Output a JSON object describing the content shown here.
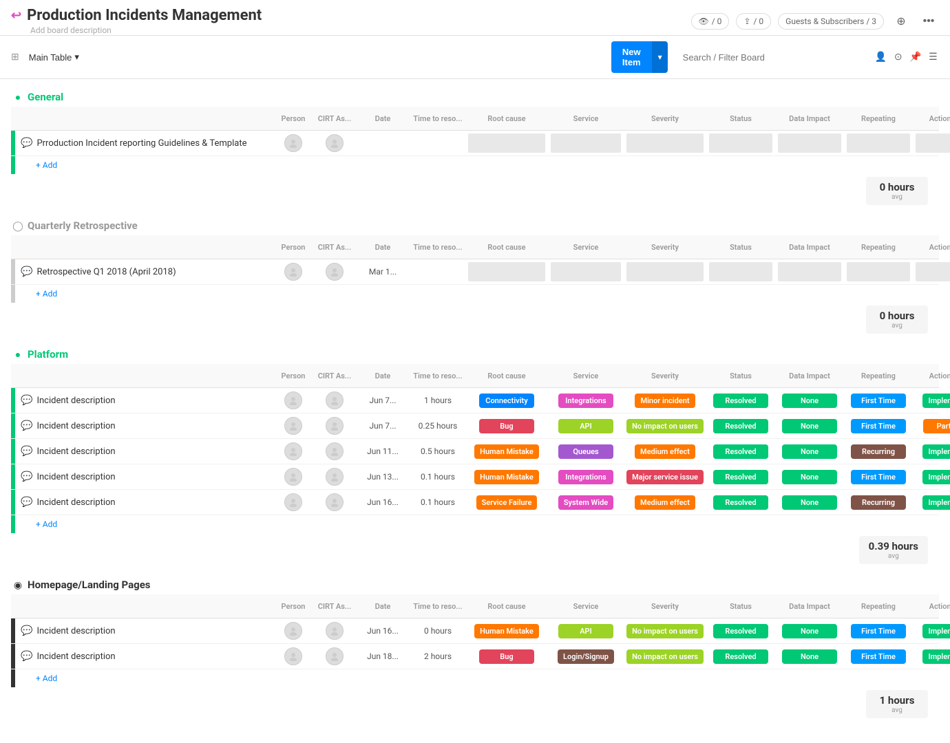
{
  "app": {
    "title": "Production Incidents Management",
    "title_icon": "↩",
    "board_desc": "Add board description",
    "counters": {
      "eye": "/ 0",
      "share": "/ 0",
      "guests": "Guests & Subscribers / 3"
    }
  },
  "toolbar": {
    "table_label": "Main Table",
    "new_item_label": "New Item",
    "search_placeholder": "Search / Filter Board"
  },
  "columns": [
    "Person",
    "CIRT As...",
    "Date",
    "Time to reso...",
    "Root cause",
    "Service",
    "Severity",
    "Status",
    "Data Impact",
    "Repeating",
    "Action Items"
  ],
  "groups": [
    {
      "id": "general",
      "title": "General",
      "color": "green",
      "indicator_color": "green",
      "rows": [
        {
          "name": "Prroduction Incident reporting Guidelines & Template",
          "date": "",
          "time": "",
          "has_tags": false
        }
      ],
      "summary": "0 hours",
      "summary_label": "avg"
    },
    {
      "id": "quarterly",
      "title": "Quarterly Retrospective",
      "color": "gray",
      "indicator_color": "gray",
      "rows": [
        {
          "name": "Retrospective Q1 2018 (April 2018)",
          "date": "Mar 1...",
          "time": "",
          "has_tags": false
        }
      ],
      "summary": "0 hours",
      "summary_label": "avg"
    },
    {
      "id": "platform",
      "title": "Platform",
      "color": "green",
      "indicator_color": "green",
      "rows": [
        {
          "name": "Incident description",
          "date": "Jun 7...",
          "time": "1 hours",
          "root_cause": "Connectivity",
          "root_cause_color": "tag-blue",
          "service": "Integrations",
          "service_color": "tag-pink",
          "severity": "Minor incident",
          "severity_color": "tag-orange",
          "status": "Resolved",
          "status_color": "tag-green",
          "impact": "None",
          "impact_color": "tag-green",
          "repeating": "First Time",
          "repeating_color": "tag-teal",
          "action": "Implemented",
          "action_color": "tag-green"
        },
        {
          "name": "Incident description",
          "date": "Jun 7...",
          "time": "0.25 hours",
          "root_cause": "Bug",
          "root_cause_color": "tag-red",
          "service": "API",
          "service_color": "tag-light-green",
          "severity": "No impact on users",
          "severity_color": "tag-light-green",
          "status": "Resolved",
          "status_color": "tag-green",
          "impact": "None",
          "impact_color": "tag-green",
          "repeating": "First Time",
          "repeating_color": "tag-teal",
          "action": "Partially",
          "action_color": "tag-dark-orange"
        },
        {
          "name": "Incident description",
          "date": "Jun 11...",
          "time": "0.5 hours",
          "root_cause": "Human Mistake",
          "root_cause_color": "tag-orange",
          "service": "Queues",
          "service_color": "tag-purple",
          "severity": "Medium effect",
          "severity_color": "tag-orange",
          "status": "Resolved",
          "status_color": "tag-green",
          "impact": "None",
          "impact_color": "tag-green",
          "repeating": "Recurring",
          "repeating_color": "tag-brown",
          "action": "Implemented",
          "action_color": "tag-green"
        },
        {
          "name": "Incident description",
          "date": "Jun 13...",
          "time": "0.1 hours",
          "root_cause": "Human Mistake",
          "root_cause_color": "tag-orange",
          "service": "Integrations",
          "service_color": "tag-pink",
          "severity": "Major service issue",
          "severity_color": "tag-red",
          "status": "Resolved",
          "status_color": "tag-green",
          "impact": "None",
          "impact_color": "tag-green",
          "repeating": "First Time",
          "repeating_color": "tag-teal",
          "action": "Implemented",
          "action_color": "tag-green"
        },
        {
          "name": "Incident description",
          "date": "Jun 16...",
          "time": "0.1 hours",
          "root_cause": "Service Failure",
          "root_cause_color": "tag-orange",
          "service": "System Wide",
          "service_color": "tag-pink",
          "severity": "Medium effect",
          "severity_color": "tag-orange",
          "status": "Resolved",
          "status_color": "tag-green",
          "impact": "None",
          "impact_color": "tag-green",
          "repeating": "Recurring",
          "repeating_color": "tag-brown",
          "action": "Implemented",
          "action_color": "tag-green"
        }
      ],
      "summary": "0.39 hours",
      "summary_label": "avg"
    },
    {
      "id": "homepage",
      "title": "Homepage/Landing Pages",
      "color": "black",
      "indicator_color": "black",
      "rows": [
        {
          "name": "Incident description",
          "date": "Jun 16...",
          "time": "0 hours",
          "root_cause": "Human Mistake",
          "root_cause_color": "tag-orange",
          "service": "API",
          "service_color": "tag-light-green",
          "severity": "No impact on users",
          "severity_color": "tag-light-green",
          "status": "Resolved",
          "status_color": "tag-green",
          "impact": "None",
          "impact_color": "tag-green",
          "repeating": "First Time",
          "repeating_color": "tag-teal",
          "action": "Implemented",
          "action_color": "tag-green"
        },
        {
          "name": "Incident description",
          "date": "Jun 18...",
          "time": "2 hours",
          "root_cause": "Bug",
          "root_cause_color": "tag-red",
          "service": "Login/Signup",
          "service_color": "tag-brown",
          "severity": "No impact on users",
          "severity_color": "tag-light-green",
          "status": "Resolved",
          "status_color": "tag-green",
          "impact": "None",
          "impact_color": "tag-green",
          "repeating": "First Time",
          "repeating_color": "tag-teal",
          "action": "Implemented",
          "action_color": "tag-green"
        }
      ],
      "summary": "1 hours",
      "summary_label": "avg"
    }
  ],
  "add_item_label": "+ Add",
  "view_label": "Table"
}
